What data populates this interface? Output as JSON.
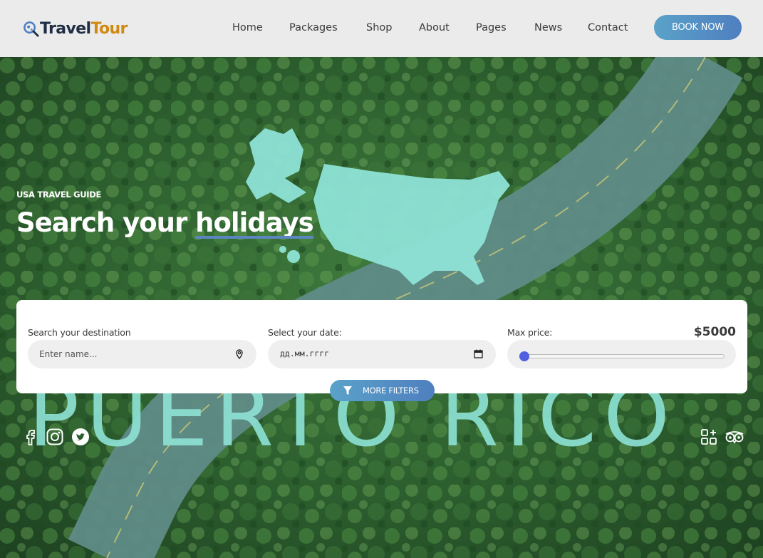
{
  "header": {
    "logo_part1": "Travel",
    "logo_part2": "Tour",
    "nav": [
      {
        "label": "Home"
      },
      {
        "label": "Packages"
      },
      {
        "label": "Shop"
      },
      {
        "label": "About"
      },
      {
        "label": "Pages"
      },
      {
        "label": "News"
      },
      {
        "label": "Contact"
      }
    ],
    "cta": "BOOK NOW"
  },
  "hero": {
    "eyebrow": "USA TRAVEL GUIDE",
    "headline_prefix": "Search your ",
    "headline_highlight": "holidays",
    "background_text": "PUERTO RICO"
  },
  "search": {
    "destination_label": "Search your destination",
    "destination_placeholder": "Enter name...",
    "date_label": "Select your date:",
    "date_value": "дд.мм.гггг",
    "price_label": "Max price:",
    "price_value": "$5000",
    "price_slider_fraction": 0,
    "more_filters": "MORE FILTERS"
  },
  "social": [
    "facebook-icon",
    "instagram-icon",
    "twitter-icon"
  ],
  "right_icons": [
    "apps-icon",
    "tripadvisor-icon"
  ],
  "colors": {
    "accent_gradient_start": "#5aa2c9",
    "accent_gradient_end": "#4f7fbf",
    "logo_dark": "#1f2e44",
    "logo_orange": "#d08a12",
    "map_fill": "#8ee3d6",
    "slider_thumb": "#4f5fe0"
  }
}
